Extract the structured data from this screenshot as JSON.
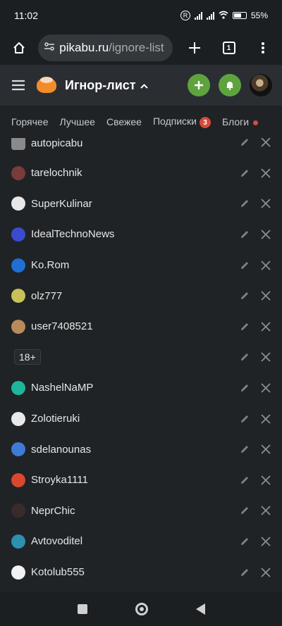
{
  "status_bar": {
    "time": "11:02",
    "battery": "55%"
  },
  "browser": {
    "url_domain": "pikabu.ru",
    "url_path": "/ignore-list",
    "tab_count": "1"
  },
  "header": {
    "title": "Игнор-лист"
  },
  "nav_tabs": [
    {
      "label": "Горячее"
    },
    {
      "label": "Лучшее"
    },
    {
      "label": "Свежее"
    },
    {
      "label": "Подписки",
      "badge": "3"
    },
    {
      "label": "Блоги"
    }
  ],
  "ignore_list": {
    "partial_user": "autopicabu",
    "users": [
      {
        "name": "tarelochnik",
        "avatar_color": "#7a3b3b"
      },
      {
        "name": "SuperKulinar",
        "avatar_color": "#e8e8e8"
      },
      {
        "name": "IdealTechnoNews",
        "avatar_color": "#3b4bd0"
      },
      {
        "name": "Ko.Rom",
        "avatar_color": "#1e6fd6"
      },
      {
        "name": "olz777",
        "avatar_color": "#c9c25a"
      },
      {
        "name": "user7408521",
        "avatar_color": "#b98a5b"
      },
      {
        "name": "18+",
        "avatar_color": ""
      },
      {
        "name": "NashelNaMP",
        "avatar_color": "#1eb59a"
      },
      {
        "name": "Zolotieruki",
        "avatar_color": "#e9e9e9"
      },
      {
        "name": "sdelanounas",
        "avatar_color": "#3e7bd6"
      },
      {
        "name": "Stroyka1111",
        "avatar_color": "#d9472f"
      },
      {
        "name": "NeprChic",
        "avatar_color": "#3a2b2b"
      },
      {
        "name": "Avtovoditel",
        "avatar_color": "#2f8fb0"
      },
      {
        "name": "Kotolub555",
        "avatar_color": "#f2f2f2"
      }
    ]
  }
}
